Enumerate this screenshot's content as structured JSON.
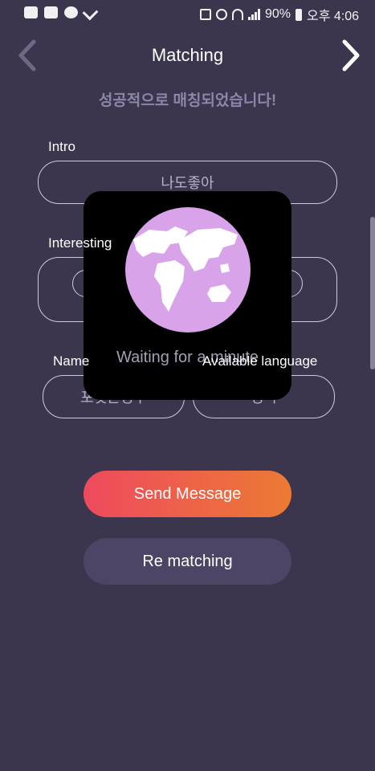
{
  "status_bar": {
    "battery": "90%",
    "time": "오후 4:06"
  },
  "header": {
    "title": "Matching",
    "subtitle": "성공적으로 매칭되었습니다!"
  },
  "fields": {
    "intro": {
      "label": "Intro",
      "value": "나도좋아"
    },
    "interesting": {
      "label": "Interesting"
    },
    "name": {
      "label": "Name",
      "value": "포켓몬영구"
    },
    "language": {
      "label": "Available language",
      "value": "영국"
    }
  },
  "buttons": {
    "send": "Send Message",
    "rematch": "Re matching"
  },
  "modal": {
    "message": "Waiting for a minute"
  }
}
